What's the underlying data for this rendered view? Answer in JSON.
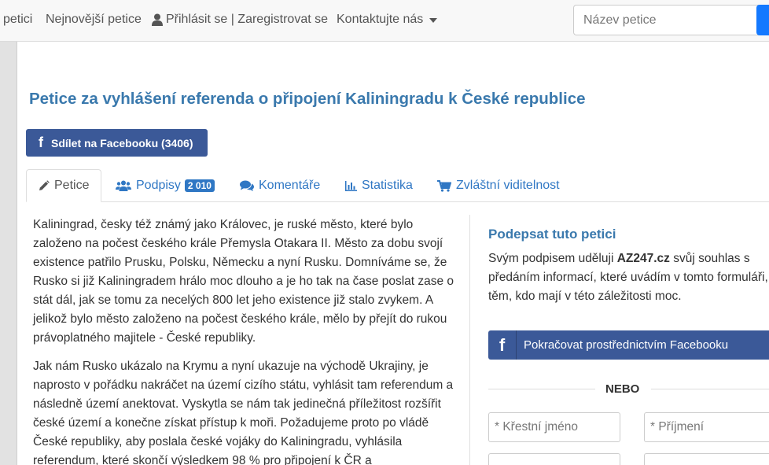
{
  "nav": {
    "items": [
      "petici",
      "Nejnovější petice",
      "Přihlásit se | Zaregistrovat se",
      "Kontaktujte nás"
    ],
    "search_placeholder": "Název petice"
  },
  "petition": {
    "title": "Petice za vyhlášení referenda o připojení Kaliningradu k České republice",
    "share_button": "Sdílet na Facebooku (3406)",
    "tabs": [
      {
        "label": "Petice",
        "icon": "pencil-icon"
      },
      {
        "label": "Podpisy",
        "badge": "2 010",
        "icon": "users-icon"
      },
      {
        "label": "Komentáře",
        "icon": "comments-icon"
      },
      {
        "label": "Statistika",
        "icon": "bar-chart-icon"
      },
      {
        "label": "Zvláštní viditelnost",
        "icon": "cart-icon"
      }
    ],
    "paragraphs": [
      "Kaliningrad, česky též známý jako Královec, je ruské město, které bylo založeno na počest českého krále Přemysla Otakara II. Město za dobu svojí existence patřilo Prusku, Polsku, Německu a nyní Rusku. Domníváme se, že Rusko si již Kaliningradem hrálo moc dlouho a je ho tak na čase poslat zase o stát dál, jak se tomu za necelých 800 let jeho existence již stalo zvykem. A jelikož bylo město založeno na počest českého krále, mělo by přejít do rukou právoplatného majitele - České republiky.",
      "Jak nám Rusko ukázalo na Krymu a nyní ukazuje na východě Ukrajiny, je naprosto v pořádku nakráčet na území cizího státu, vyhlásit tam referendum a následně území anektovat. Vyskytla se nám tak jedinečná příležitost rozšířit české území a konečne získat přístup k moři. Požadujeme proto po vládě České republiky, aby poslala české vojáky do Kaliningradu, vyhlásila referendum, které skončí výsledkem 98 % pro připojení k ČR a"
    ]
  },
  "sign": {
    "title": "Podepsat tuto petici",
    "text_before": "Svým podpisem uděluji ",
    "brand": "AZ247.cz",
    "text_after": " svůj souhlas s předáním informací, které uvádím v tomto formuláři, těm, kdo mají v této záležitosti moc.",
    "fb_button": "Pokračovat prostřednictvím Facebooku",
    "or": "NEBO",
    "first_name_placeholder": "* Křestní jméno",
    "last_name_placeholder": "* Příjmení"
  },
  "colors": {
    "brand_blue": "#3a79ad",
    "link_blue": "#2f77c4",
    "facebook": "#3b5998"
  }
}
